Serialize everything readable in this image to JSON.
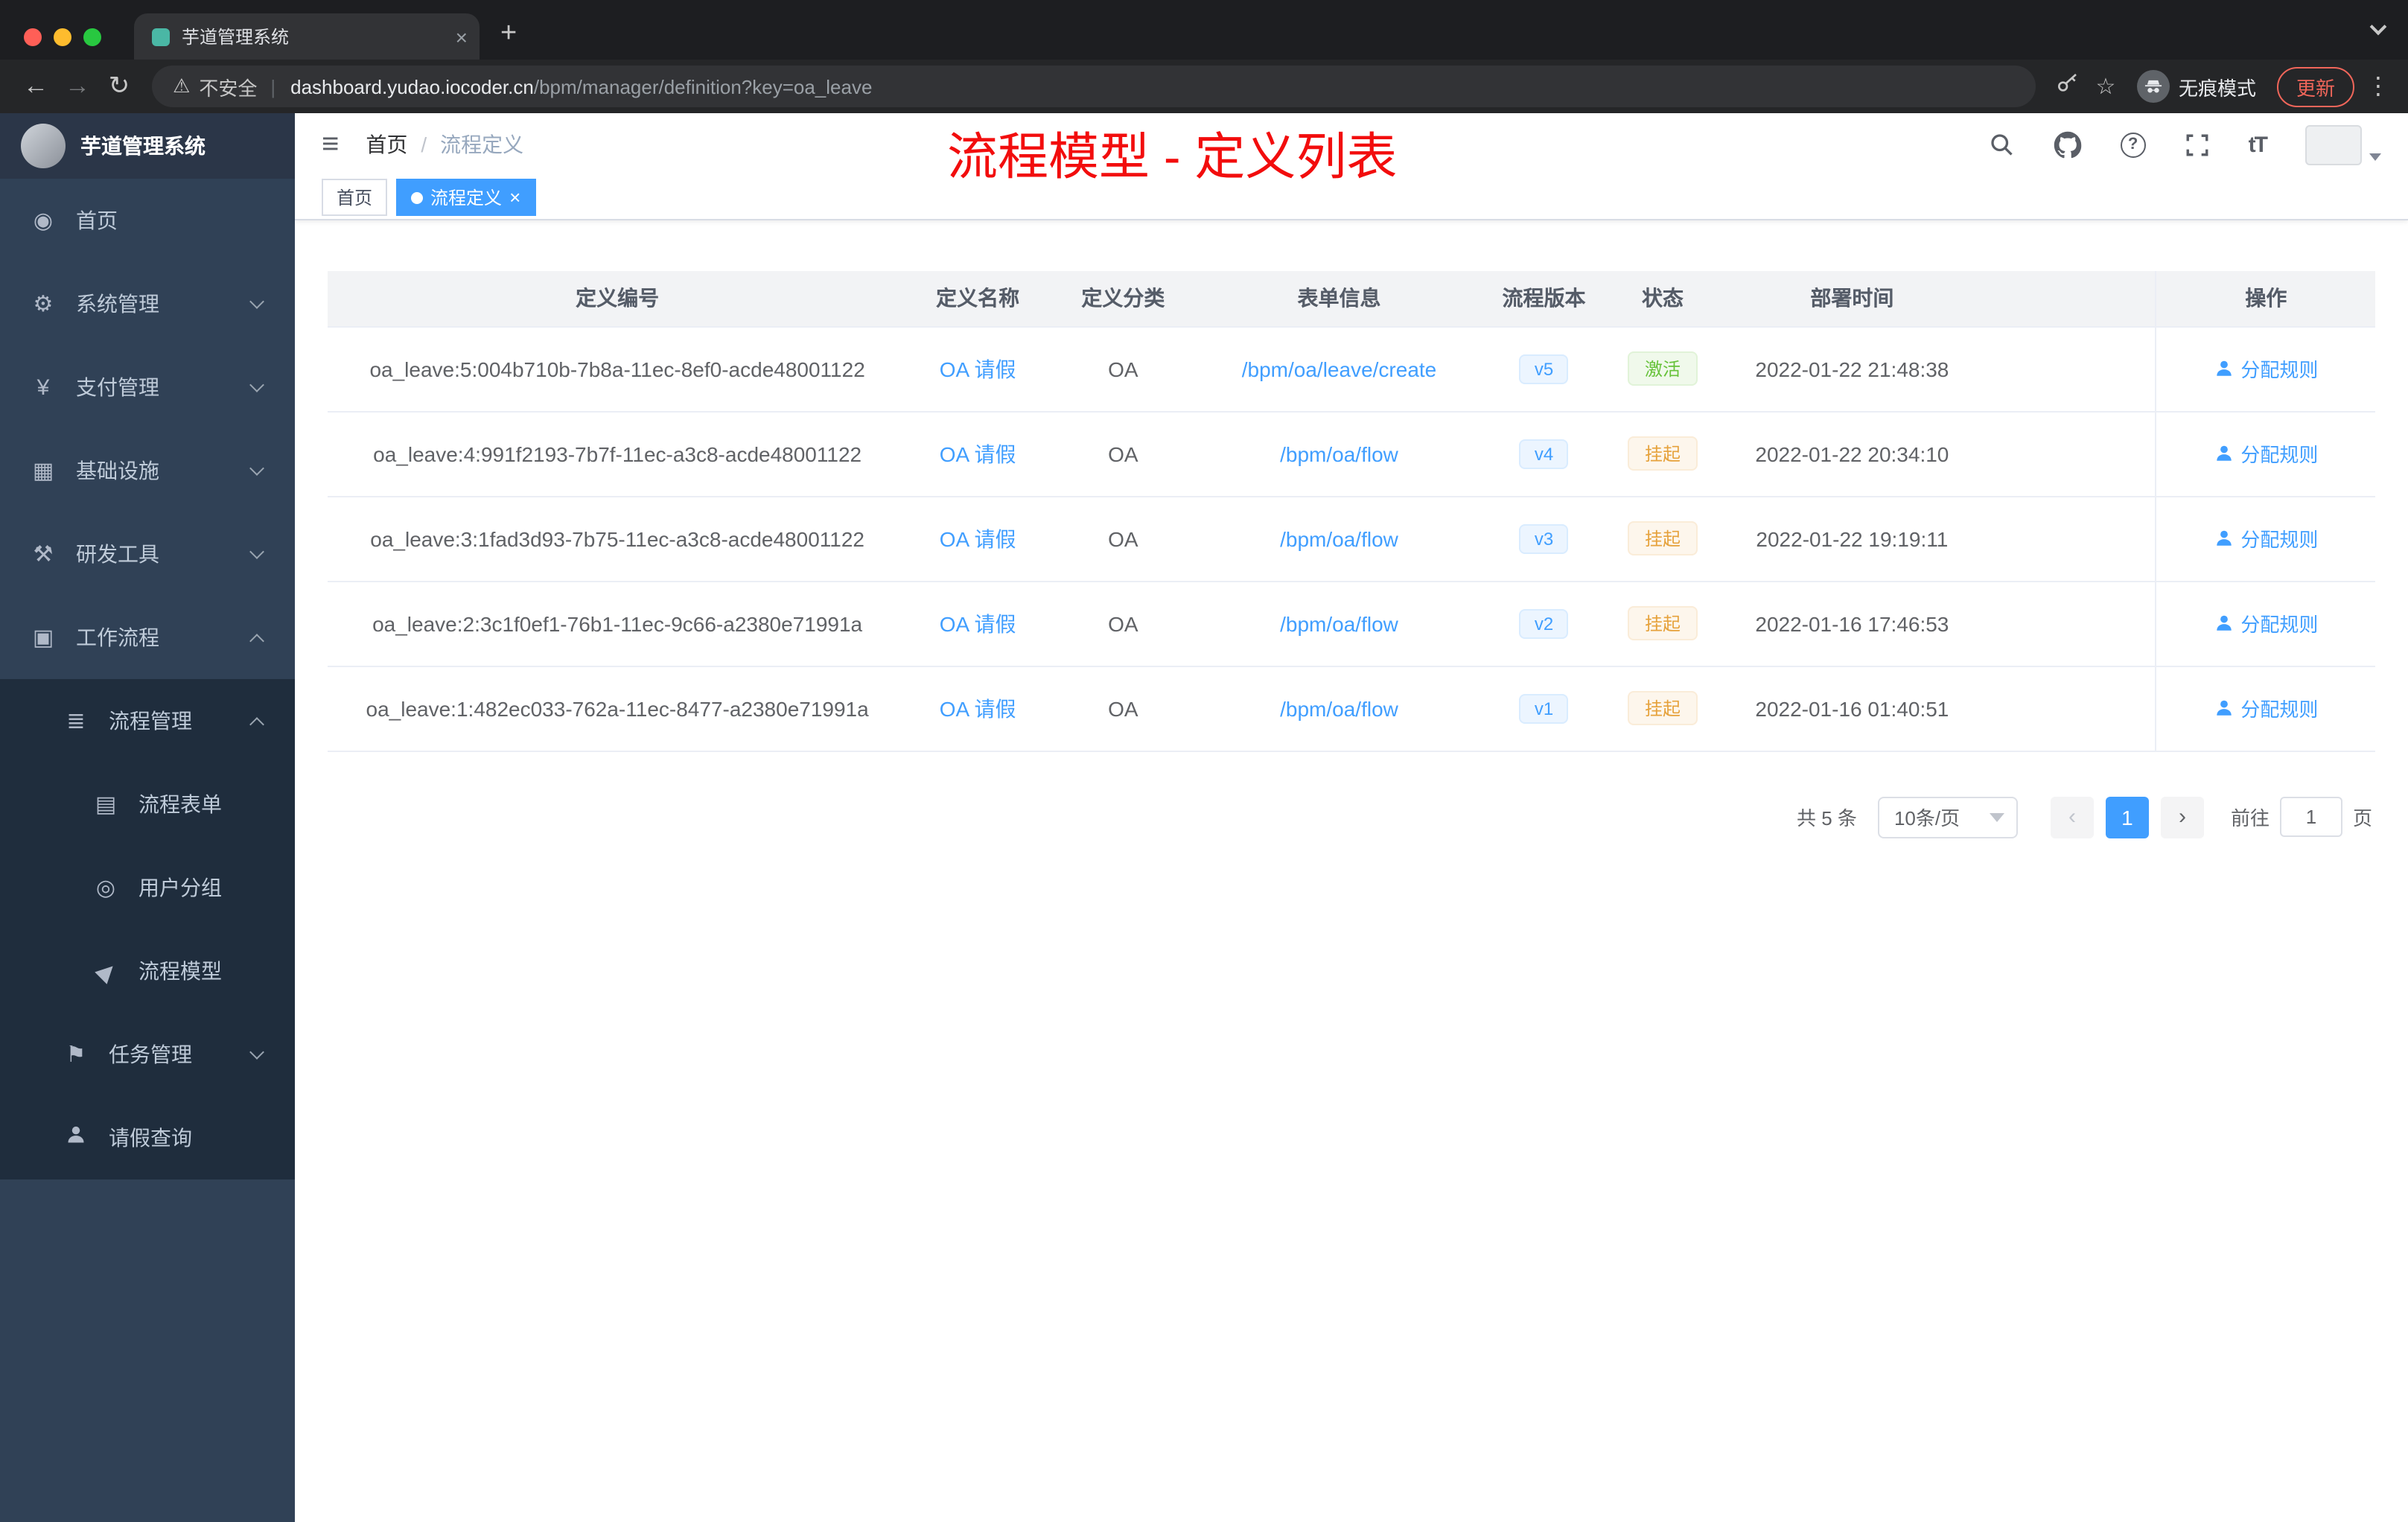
{
  "browser": {
    "tab": {
      "title": "芋道管理系统"
    },
    "address": {
      "security_label": "不安全",
      "host": "dashboard.yudao.iocoder.cn",
      "path": "/bpm/manager/definition?key=oa_leave",
      "incognito_label": "无痕模式",
      "update_label": "更新"
    }
  },
  "icons": {
    "back": "←",
    "forward": "→",
    "reload": "↻",
    "warning": "⚠",
    "separator": "|",
    "star": "☆",
    "kebab": "⋮",
    "plus": "+",
    "close": "×",
    "hamburger": "≡",
    "breadcrumb_sep": "/",
    "fontsize": "tT",
    "question": "?",
    "prev": "‹",
    "next": "›"
  },
  "sidebar": {
    "logo_title": "芋道管理系统",
    "menu": [
      {
        "label": "首页",
        "glyph": "◉"
      },
      {
        "label": "系统管理",
        "glyph": "⚙"
      },
      {
        "label": "支付管理",
        "glyph": "¥"
      },
      {
        "label": "基础设施",
        "glyph": "▦"
      },
      {
        "label": "研发工具",
        "glyph": "⚒"
      },
      {
        "label": "工作流程",
        "glyph": "▣"
      },
      {
        "label": "流程管理",
        "glyph": "≣"
      },
      {
        "label": "流程表单",
        "glyph": "▤"
      },
      {
        "label": "用户分组",
        "glyph": "◎"
      },
      {
        "label": "流程模型",
        "glyph": "▶"
      },
      {
        "label": "任务管理",
        "glyph": "⚑"
      },
      {
        "label": "请假查询",
        "glyph": ""
      }
    ]
  },
  "header": {
    "breadcrumb": [
      {
        "label": "首页"
      },
      {
        "label": "流程定义"
      }
    ],
    "overlay_title": "流程模型 - 定义列表"
  },
  "tags": [
    {
      "label": "首页"
    },
    {
      "label": "流程定义"
    }
  ],
  "table": {
    "columns": [
      "定义编号",
      "定义名称",
      "定义分类",
      "表单信息",
      "流程版本",
      "状态",
      "部署时间",
      "操作"
    ],
    "action_label": "分配规则",
    "rows": [
      {
        "id": "oa_leave:5:004b710b-7b8a-11ec-8ef0-acde48001122",
        "name": "OA 请假",
        "category": "OA",
        "form": "/bpm/oa/leave/create",
        "version": "v5",
        "status": "激活",
        "time": "2022-01-22 21:48:38"
      },
      {
        "id": "oa_leave:4:991f2193-7b7f-11ec-a3c8-acde48001122",
        "name": "OA 请假",
        "category": "OA",
        "form": "/bpm/oa/flow",
        "version": "v4",
        "status": "挂起",
        "time": "2022-01-22 20:34:10"
      },
      {
        "id": "oa_leave:3:1fad3d93-7b75-11ec-a3c8-acde48001122",
        "name": "OA 请假",
        "category": "OA",
        "form": "/bpm/oa/flow",
        "version": "v3",
        "status": "挂起",
        "time": "2022-01-22 19:19:11"
      },
      {
        "id": "oa_leave:2:3c1f0ef1-76b1-11ec-9c66-a2380e71991a",
        "name": "OA 请假",
        "category": "OA",
        "form": "/bpm/oa/flow",
        "version": "v2",
        "status": "挂起",
        "time": "2022-01-16 17:46:53"
      },
      {
        "id": "oa_leave:1:482ec033-762a-11ec-8477-a2380e71991a",
        "name": "OA 请假",
        "category": "OA",
        "form": "/bpm/oa/flow",
        "version": "v1",
        "status": "挂起",
        "time": "2022-01-16 01:40:51"
      }
    ]
  },
  "pagination": {
    "total_label": "共 5 条",
    "page_size_label": "10条/页",
    "current_page": "1",
    "goto_label": "前往",
    "goto_value": "1",
    "page_label": "页"
  },
  "colors": {
    "accent": "#409eff",
    "success": "#67c23a",
    "warning": "#e6a23c",
    "annotation_red": "#f20d0d",
    "sidebar_bg": "#304156",
    "sidebar_sub_bg": "#1f2d3d"
  }
}
